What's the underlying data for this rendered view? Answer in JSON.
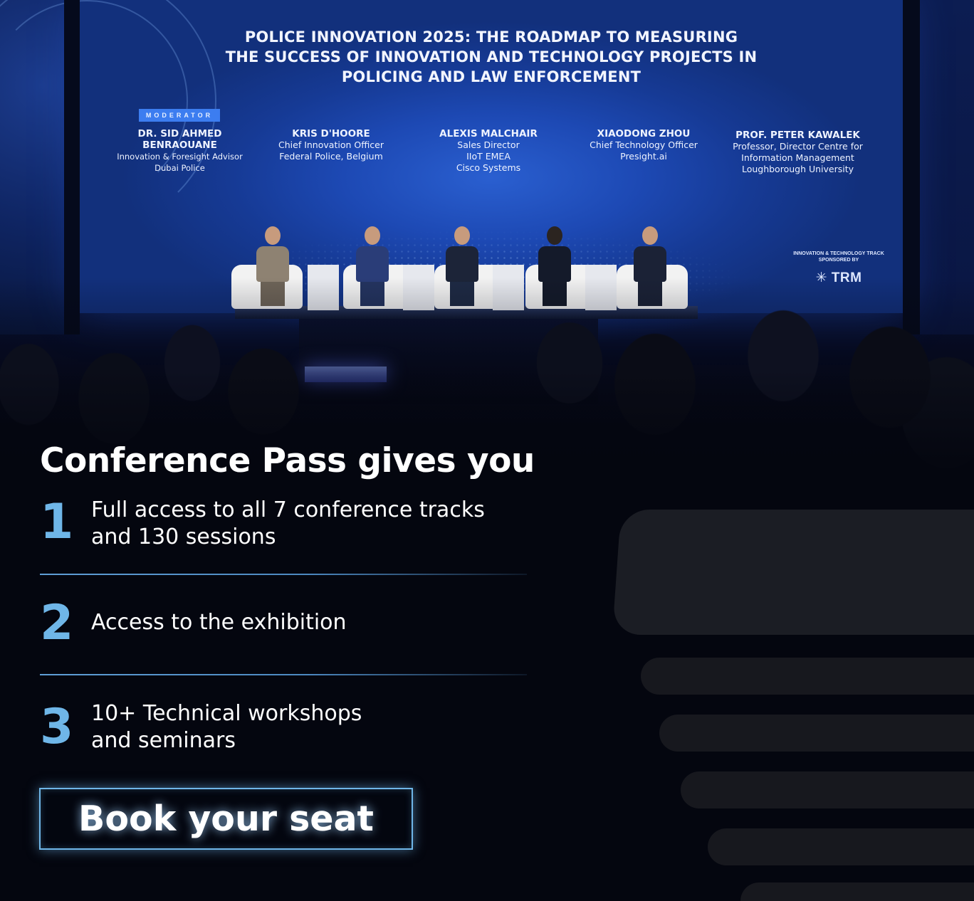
{
  "stage": {
    "title_lines": [
      "POLICE INNOVATION 2025: THE ROADMAP TO MEASURING",
      "THE SUCCESS OF INNOVATION AND TECHNOLOGY PROJECTS IN",
      "POLICING AND LAW ENFORCEMENT"
    ],
    "moderator_badge": "MODERATOR",
    "speakers": [
      {
        "name_lines": [
          "DR. SID AHMED",
          "BENRAOUANE"
        ],
        "lines": [
          "Innovation & Foresight Advisor",
          "Dubai Police"
        ]
      },
      {
        "name_lines": [
          "KRIS D'HOORE"
        ],
        "lines": [
          "Chief Innovation Officer",
          "Federal Police, Belgium"
        ]
      },
      {
        "name_lines": [
          "ALEXIS MALCHAIR"
        ],
        "lines": [
          "Sales Director",
          "IIoT EMEA",
          "Cisco Systems"
        ]
      },
      {
        "name_lines": [
          "XIAODONG ZHOU"
        ],
        "lines": [
          "Chief Technology Officer",
          "Presight.ai"
        ]
      },
      {
        "name_lines": [
          "PROF. PETER KAWALEK"
        ],
        "lines": [
          "Professor, Director Centre for",
          "Information Management",
          "Loughborough University"
        ]
      }
    ],
    "sponsor": {
      "line1": "INNOVATION & TECHNOLOGY TRACK",
      "line2": "SPONSORED BY",
      "brand": "TRM",
      "brand_icon": "asterisk-icon"
    }
  },
  "content": {
    "headline": "Conference Pass gives you",
    "benefits": [
      {
        "num": "1",
        "lines": [
          "Full access to all 7 conference tracks",
          "and 130 sessions"
        ]
      },
      {
        "num": "2",
        "lines": [
          "Access to the exhibition"
        ]
      },
      {
        "num": "3",
        "lines": [
          "10+ Technical workshops",
          "and seminars"
        ]
      }
    ],
    "cta_label": "Book your seat"
  },
  "colors": {
    "accent": "#6fb6e8",
    "background": "#04060f",
    "text": "#ffffff",
    "stage_blue": "#1d49b4"
  }
}
